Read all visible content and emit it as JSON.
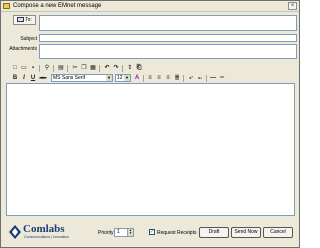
{
  "window": {
    "title": "Compose a new EMnet message",
    "close_glyph": "×"
  },
  "header": {
    "to_label": "To:",
    "subject_label": "Subject",
    "attachments_label": "Attachments",
    "to_value": "",
    "subject_value": "",
    "attachments_value": ""
  },
  "toolbar1": {
    "new": "□",
    "open": "▭",
    "save": "▪",
    "find": "⚲",
    "print": "▤",
    "cut": "✂",
    "copy": "❐",
    "paste": "▦",
    "undo": "↶",
    "redo": "↷",
    "attach": "⇪",
    "insert": "⎗"
  },
  "toolbar2": {
    "bold": "B",
    "italic": "I",
    "underline": "U",
    "strike": "abc",
    "font_name": "MS Sans Serif",
    "font_size": "12",
    "color": "A",
    "align_left": "≡",
    "align_center": "≡",
    "align_right": "≡",
    "justify": "≣",
    "superscript": "x²",
    "subscript": "x₂",
    "hr": "—",
    "list": "═"
  },
  "editor": {
    "body": ""
  },
  "footer": {
    "logo_word": "Comlabs",
    "logo_tagline": "Communications | Innovation",
    "priority_label": "Priority",
    "priority_value": "1",
    "request_receipts_label": "Request Receipts",
    "request_receipts_checked": true,
    "draft_label": "Draft",
    "send_now_label": "Send Now",
    "cancel_label": "Cancel"
  },
  "colors": {
    "chrome": "#ece9d8",
    "input_border": "#7f9db9",
    "brand": "#1f3a7a"
  }
}
